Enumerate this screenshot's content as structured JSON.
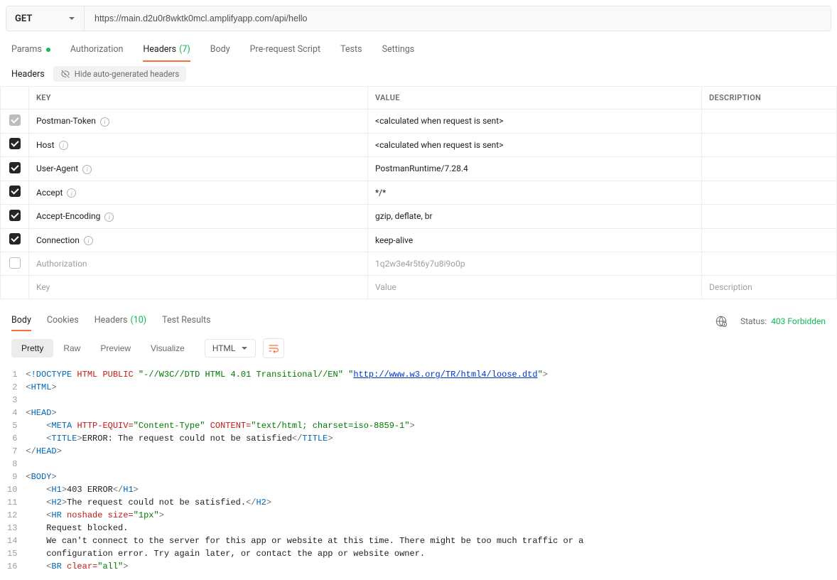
{
  "request": {
    "method": "GET",
    "url": "https://main.d2u0r8wktk0mcl.amplifyapp.com/api/hello"
  },
  "reqTabs": {
    "params": "Params",
    "auth": "Authorization",
    "headers": "Headers",
    "headers_count": "(7)",
    "body": "Body",
    "prerequest": "Pre-request Script",
    "tests": "Tests",
    "settings": "Settings"
  },
  "headersSection": {
    "title": "Headers",
    "hideBtn": "Hide auto-generated headers",
    "cols": {
      "key": "KEY",
      "value": "VALUE",
      "description": "DESCRIPTION"
    },
    "rows": [
      {
        "checked": true,
        "disabled": true,
        "key": "Postman-Token",
        "info": true,
        "value": "<calculated when request is sent>",
        "faded": false
      },
      {
        "checked": true,
        "disabled": false,
        "key": "Host",
        "info": true,
        "value": "<calculated when request is sent>",
        "faded": false
      },
      {
        "checked": true,
        "disabled": false,
        "key": "User-Agent",
        "info": true,
        "value": "PostmanRuntime/7.28.4",
        "faded": false
      },
      {
        "checked": true,
        "disabled": false,
        "key": "Accept",
        "info": true,
        "value": "*/*",
        "faded": false
      },
      {
        "checked": true,
        "disabled": false,
        "key": "Accept-Encoding",
        "info": true,
        "value": "gzip, deflate, br",
        "faded": false
      },
      {
        "checked": true,
        "disabled": false,
        "key": "Connection",
        "info": true,
        "value": "keep-alive",
        "faded": false
      },
      {
        "checked": false,
        "disabled": false,
        "key": "Authorization",
        "info": false,
        "value": "1q2w3e4r5t6y7u8i9o0p",
        "faded": true
      }
    ],
    "placeholder": {
      "key": "Key",
      "value": "Value",
      "description": "Description"
    }
  },
  "respTabs": {
    "body": "Body",
    "cookies": "Cookies",
    "headers": "Headers",
    "headers_count": "(10)",
    "testresults": "Test Results"
  },
  "status": {
    "label": "Status:",
    "value": "403 Forbidden"
  },
  "bodyViews": {
    "pretty": "Pretty",
    "raw": "Raw",
    "preview": "Preview",
    "visualize": "Visualize",
    "lang": "HTML"
  },
  "responseCode": {
    "lines": [
      1,
      2,
      3,
      4,
      5,
      6,
      7,
      8,
      9,
      10,
      11,
      12,
      13,
      14,
      15,
      16
    ],
    "l1_a": "!DOCTYPE",
    "l1_b": "HTML",
    "l1_c": "PUBLIC",
    "l1_d": "\"-//W3C//DTD HTML 4.01 Transitional//EN\"",
    "l1_e": "\"",
    "l1_f": "http://www.w3.org/TR/html4/loose.dtd",
    "l1_g": "\"",
    "l2": "HTML",
    "l4": "HEAD",
    "l5_a": "META",
    "l5_b": "HTTP-EQUIV=",
    "l5_c": "\"Content-Type\"",
    "l5_d": "CONTENT=",
    "l5_e": "\"text/html; charset=iso-8859-1\"",
    "l6_a": "TITLE",
    "l6_b": "ERROR: The request could not be satisfied",
    "l6_c": "TITLE",
    "l7": "HEAD",
    "l9": "BODY",
    "l10_a": "H1",
    "l10_b": "403 ERROR",
    "l10_c": "H1",
    "l11_a": "H2",
    "l11_b": "The request could not be satisfied.",
    "l11_c": "H2",
    "l12_a": "HR",
    "l12_b": "noshade",
    "l12_c": "size=",
    "l12_d": "\"1px\"",
    "l13": "Request blocked.",
    "l14": "We can't connect to the server for this app or website at this time. There might be too much traffic or a",
    "l15": "configuration error. Try again later, or contact the app or website owner.",
    "l16_a": "BR",
    "l16_b": "clear=",
    "l16_c": "\"all\""
  }
}
